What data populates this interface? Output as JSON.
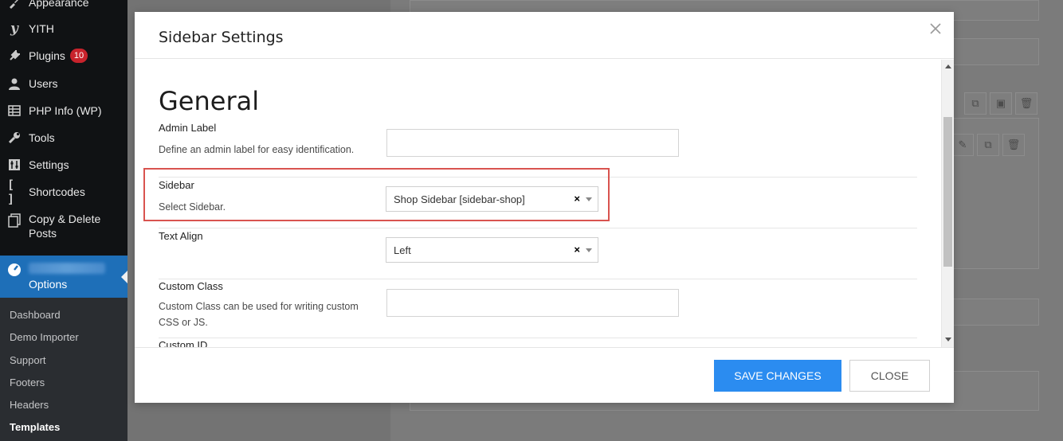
{
  "admin_menu": {
    "items": [
      {
        "label": "Appearance",
        "icon": "paintbrush-icon"
      },
      {
        "label": "YITH",
        "icon": "yith-icon"
      },
      {
        "label": "Plugins",
        "icon": "plugin-icon",
        "badge": "10"
      },
      {
        "label": "Users",
        "icon": "users-icon"
      },
      {
        "label": "PHP Info (WP)",
        "icon": "table-icon"
      },
      {
        "label": "Tools",
        "icon": "wrench-icon"
      },
      {
        "label": "Settings",
        "icon": "settings-icon"
      },
      {
        "label": "Shortcodes",
        "icon": "brackets-icon"
      },
      {
        "label": "Copy & Delete Posts",
        "icon": "copy-icon"
      }
    ],
    "active": {
      "label": "Options",
      "icon": "theme-options-icon"
    },
    "submenu": [
      "Dashboard",
      "Demo Importer",
      "Support",
      "Footers",
      "Headers",
      "Templates"
    ],
    "submenu_current": "Templates"
  },
  "modal": {
    "title": "Sidebar Settings",
    "section_title": "General",
    "fields": {
      "admin_label": {
        "label": "Admin Label",
        "description": "Define an admin label for easy identification.",
        "value": ""
      },
      "sidebar": {
        "label": "Sidebar",
        "description": "Select Sidebar.",
        "value": "Shop Sidebar [sidebar-shop]",
        "clear": "×"
      },
      "text_align": {
        "label": "Text Align",
        "value": "Left",
        "clear": "×"
      },
      "custom_class": {
        "label": "Custom Class",
        "description": "Custom Class can be used for writing custom CSS or JS.",
        "value": ""
      },
      "custom_id": {
        "label": "Custom ID"
      }
    },
    "footer": {
      "save_label": "SAVE CHANGES",
      "close_label": "CLOSE"
    }
  },
  "colors": {
    "accent": "#2b8cf0",
    "admin_active": "#1e6fb8",
    "highlight": "#d9534f",
    "badge": "#c8232c"
  }
}
